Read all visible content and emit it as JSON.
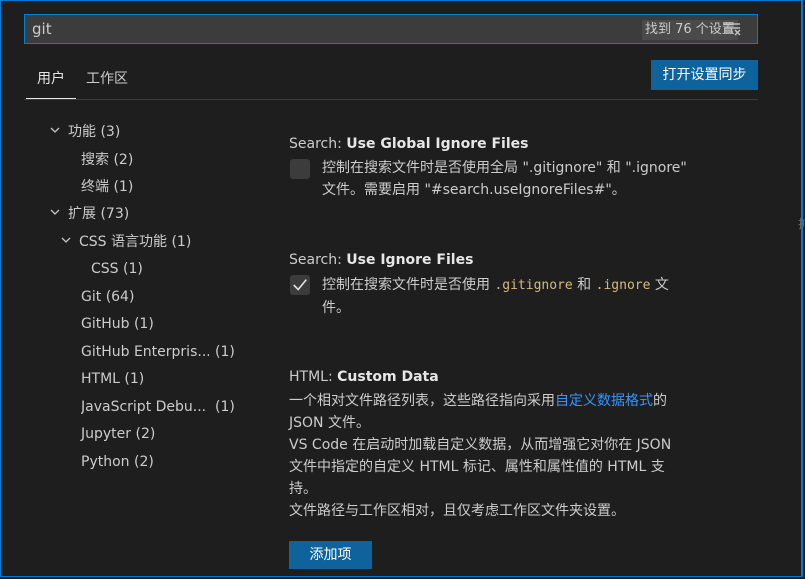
{
  "search": {
    "query": "git",
    "result_count": "找到 76 个设置"
  },
  "tabs": [
    {
      "label": "用户",
      "active": true
    },
    {
      "label": "工作区",
      "active": false
    }
  ],
  "sync_button_label": "打开设置同步",
  "toc": [
    {
      "label": "功能",
      "count": "(3)"
    },
    {
      "label": "搜索",
      "count": "(2)"
    },
    {
      "label": "终端",
      "count": "(1)"
    },
    {
      "label": "扩展",
      "count": "(73)"
    },
    {
      "label": "CSS 语言功能",
      "count": "(1)"
    },
    {
      "label": "CSS",
      "count": "(1)"
    },
    {
      "label": "Git",
      "count": "(64)"
    },
    {
      "label": "GitHub",
      "count": "(1)"
    },
    {
      "label": "GitHub Enterpris...",
      "count": "(1)"
    },
    {
      "label": "HTML",
      "count": "(1)"
    },
    {
      "label": "JavaScript Debu...",
      "count": "(1)"
    },
    {
      "label": "Jupyter",
      "count": "(2)"
    },
    {
      "label": "Python",
      "count": "(2)"
    }
  ],
  "settings": {
    "global_ignore": {
      "category": "Search: ",
      "name": "Use Global Ignore Files",
      "checked": false,
      "desc_line1": "控制在搜索文件时是否使用全局 \".gitignore\" 和 \".ignore\"",
      "desc_line2": "文件。需要启用 \"#search.useIgnoreFiles#\"。"
    },
    "ignore_files": {
      "category": "Search: ",
      "name": "Use Ignore Files",
      "checked": true,
      "desc_pre": "控制在搜索文件时是否使用 ",
      "code1": ".gitignore",
      "desc_mid": " 和 ",
      "code2": ".ignore",
      "desc_post": " 文",
      "desc_line2": "件。"
    },
    "custom_data": {
      "category": "HTML: ",
      "name": "Custom Data",
      "line1_pre": "一个相对文件路径列表，这些路径指向采用",
      "line1_link": "自定义数据格式",
      "line1_post": "的",
      "line2": "JSON 文件。",
      "line3": "VS Code 在启动时加载自定义数据，从而增强它对你在 JSON",
      "line4": "文件中指定的自定义 HTML 标记、属性和属性值的 HTML 支",
      "line5": "持。",
      "line6": "文件路径与工作区相对，且仅考虑工作区文件夹设置。",
      "add_button_label": "添加项"
    }
  },
  "colors": {
    "accent": "#0078d4",
    "button": "#0e639c",
    "link": "#3794ff",
    "code": "#d7ba7d"
  }
}
